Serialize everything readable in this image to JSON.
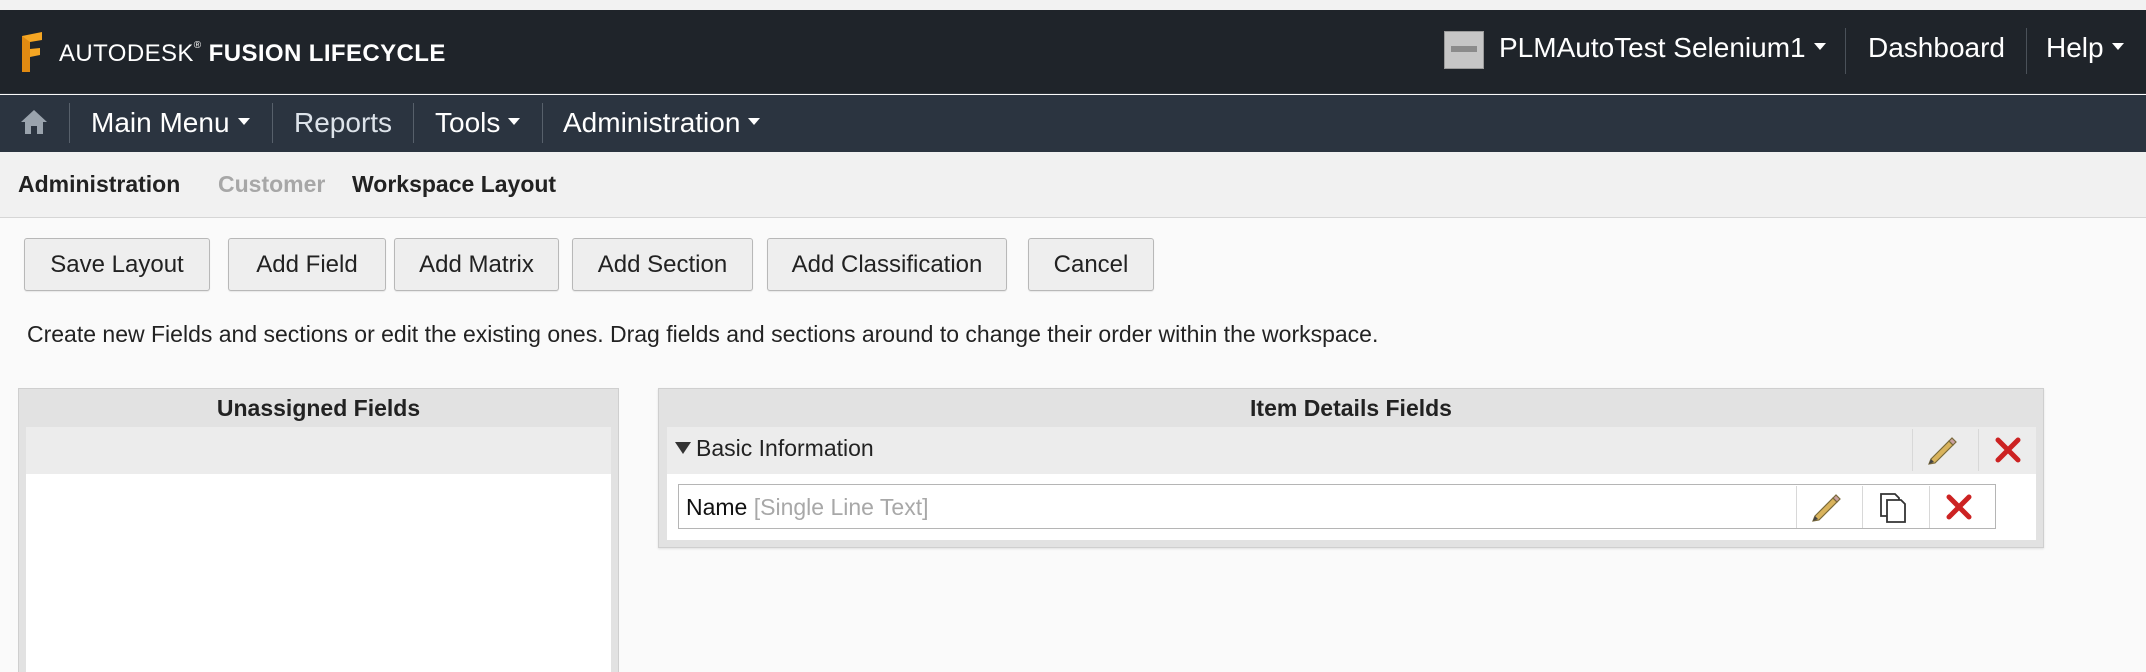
{
  "app": {
    "brand_prefix": "AUTODESK",
    "brand_registered": "®",
    "brand_product": "FUSION LIFECYCLE"
  },
  "header": {
    "user_name": "PLMAutoTest Selenium1",
    "dashboard_label": "Dashboard",
    "help_label": "Help"
  },
  "nav": {
    "items": [
      {
        "label": "Main Menu",
        "dropdown": true
      },
      {
        "label": "Reports",
        "dropdown": false
      },
      {
        "label": "Tools",
        "dropdown": true
      },
      {
        "label": "Administration",
        "dropdown": true
      }
    ]
  },
  "breadcrumb": {
    "items": [
      "Administration",
      "Customer",
      "Workspace Layout"
    ]
  },
  "toolbar": {
    "save_layout": "Save Layout",
    "add_field": "Add Field",
    "add_matrix": "Add Matrix",
    "add_section": "Add Section",
    "add_classification": "Add Classification",
    "cancel": "Cancel"
  },
  "instruction": "Create new Fields and sections or edit the existing ones. Drag fields and sections around to change their order within the workspace.",
  "unassigned_panel": {
    "title": "Unassigned Fields"
  },
  "item_details_panel": {
    "title": "Item Details Fields",
    "sections": [
      {
        "title": "Basic Information",
        "fields": [
          {
            "name": "Name",
            "type": "[Single Line Text]"
          }
        ]
      }
    ]
  },
  "colors": {
    "header_bg": "#1f242a",
    "navbar_bg": "#2b3440",
    "logo_orange": "#f5a623",
    "delete_red": "#cc2222"
  },
  "icons": {
    "logo": "fusion-logo-icon",
    "home": "home-icon",
    "edit": "pencil-icon",
    "copy": "copy-icon",
    "delete": "close-icon",
    "expand": "triangle-down-icon"
  }
}
